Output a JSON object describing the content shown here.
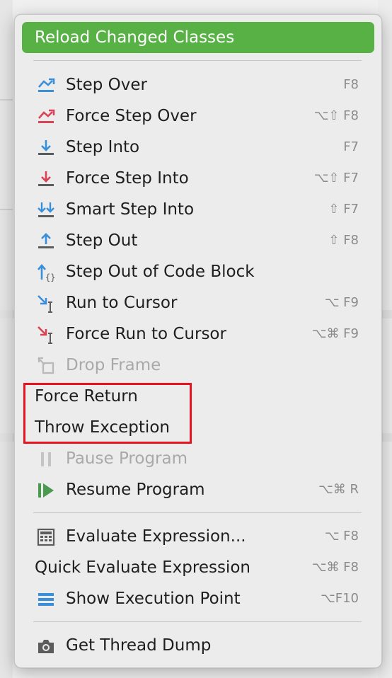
{
  "colors": {
    "accent_green": "#58b145",
    "highlight_red": "#e8131e",
    "icon_blue": "#3b8fd9",
    "icon_red": "#d84356",
    "icon_gray": "#5c5c5c",
    "resume_green": "#4a9a4f"
  },
  "menu": {
    "reload_label": "Reload Changed Classes",
    "items": [
      {
        "label": "Step Over",
        "shortcut": "F8",
        "icon": "step-over-icon",
        "enabled": true
      },
      {
        "label": "Force Step Over",
        "shortcut": "⌥⇧ F8",
        "icon": "force-step-over-icon",
        "enabled": true
      },
      {
        "label": "Step Into",
        "shortcut": "F7",
        "icon": "step-into-icon",
        "enabled": true
      },
      {
        "label": "Force Step Into",
        "shortcut": "⌥⇧ F7",
        "icon": "force-step-into-icon",
        "enabled": true
      },
      {
        "label": "Smart Step Into",
        "shortcut": "⇧ F7",
        "icon": "smart-step-into-icon",
        "enabled": true
      },
      {
        "label": "Step Out",
        "shortcut": "⇧ F8",
        "icon": "step-out-icon",
        "enabled": true
      },
      {
        "label": "Step Out of Code Block",
        "shortcut": "",
        "icon": "step-out-code-block-icon",
        "enabled": true
      },
      {
        "label": "Run to Cursor",
        "shortcut": "⌥ F9",
        "icon": "run-to-cursor-icon",
        "enabled": true
      },
      {
        "label": "Force Run to Cursor",
        "shortcut": "⌥⌘ F9",
        "icon": "force-run-to-cursor-icon",
        "enabled": true
      },
      {
        "label": "Drop Frame",
        "shortcut": "",
        "icon": "drop-frame-icon",
        "enabled": false
      },
      {
        "label": "Force Return",
        "shortcut": "",
        "icon": "",
        "enabled": true
      },
      {
        "label": "Throw Exception",
        "shortcut": "",
        "icon": "",
        "enabled": true
      },
      {
        "label": "Pause Program",
        "shortcut": "",
        "icon": "pause-icon",
        "enabled": false
      },
      {
        "label": "Resume Program",
        "shortcut": "⌥⌘ R",
        "icon": "resume-icon",
        "enabled": true
      },
      {
        "label": "Evaluate Expression...",
        "shortcut": "⌥ F8",
        "icon": "calculator-icon",
        "enabled": true
      },
      {
        "label": "Quick Evaluate Expression",
        "shortcut": "⌥⌘ F8",
        "icon": "",
        "enabled": true
      },
      {
        "label": "Show Execution Point",
        "shortcut": "⌥F10",
        "icon": "execution-point-icon",
        "enabled": true
      },
      {
        "label": "Get Thread Dump",
        "shortcut": "",
        "icon": "camera-icon",
        "enabled": true
      }
    ]
  }
}
